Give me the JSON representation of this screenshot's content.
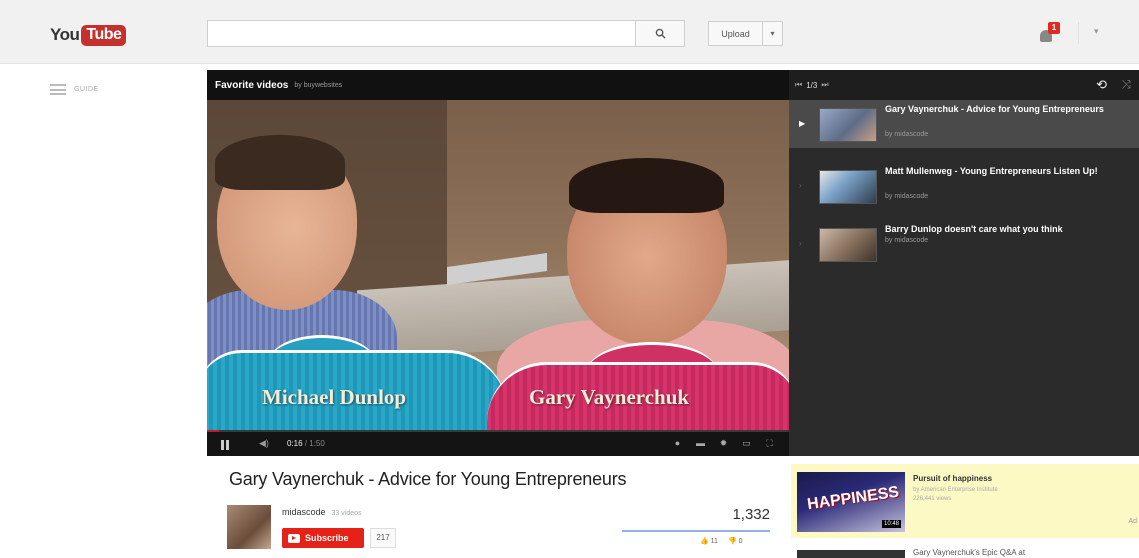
{
  "masthead": {
    "logo_you": "You",
    "logo_tube": "Tube",
    "search_value": "",
    "upload_label": "Upload",
    "notification_count": "1"
  },
  "guide": {
    "label": "GUIDE"
  },
  "player": {
    "playlist_title": "Favorite videos",
    "playlist_owner": "by buywebsites",
    "lower_third_left": "Michael Dunlop",
    "lower_third_right": "Gary Vaynerchuk",
    "time_current": "0:16",
    "time_duration": "1:50"
  },
  "playlist": {
    "position": "1/3",
    "items": [
      {
        "title": "Gary Vaynerchuk - Advice for Young Entrepreneurs",
        "by": "by midascode",
        "active": true
      },
      {
        "title": "Matt Mullenweg - Young Entrepreneurs Listen Up!",
        "by": "by midascode",
        "active": false
      },
      {
        "title": "Barry Dunlop doesn't care what you think",
        "by": "by midascode",
        "active": false
      }
    ]
  },
  "watch": {
    "title": "Gary Vaynerchuk - Advice for Young Entrepreneurs",
    "owner": "midascode",
    "owner_videos": "33 videos",
    "subscribe_label": "Subscribe",
    "subscriber_count": "217",
    "view_count": "1,332",
    "likes": "11",
    "dislikes": "0",
    "like_ratio": 1.0
  },
  "related": [
    {
      "title": "Pursuit of happiness",
      "by": "by American Enterprise Institute",
      "views": "226,441 views",
      "duration": "10:48",
      "thumb_text": "HAPPINESS",
      "ad_label": "Ad"
    },
    {
      "title": "Gary Vaynerchuk's Epic Q&A at"
    }
  ]
}
